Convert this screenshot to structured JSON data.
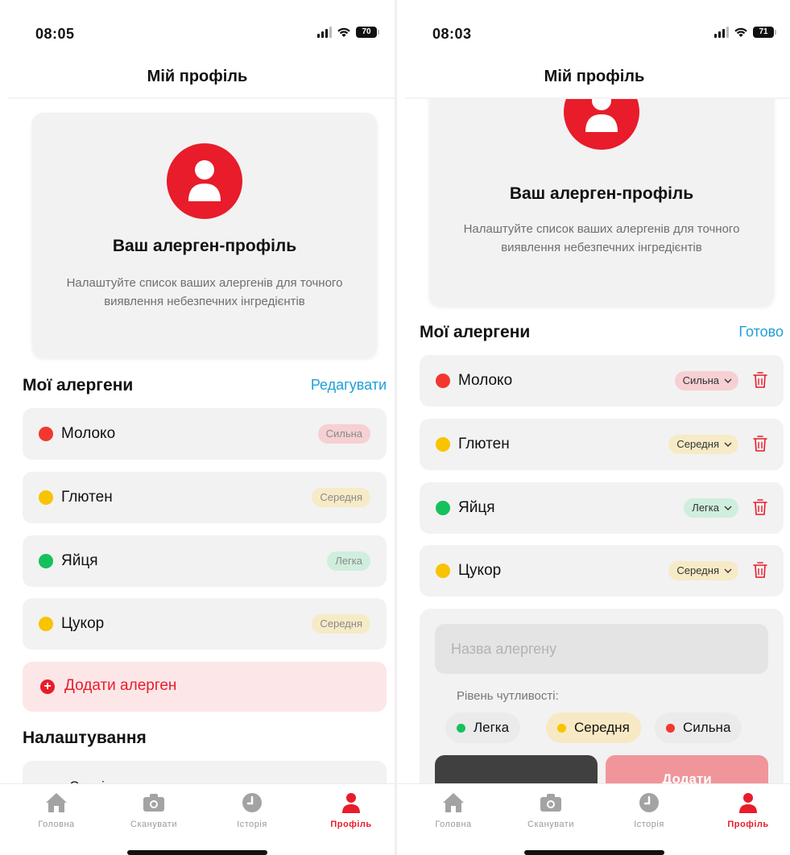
{
  "colors": {
    "accent": "#e81c2a",
    "link": "#1e9fd8",
    "strong": "#f2372f",
    "medium": "#f8c400",
    "light": "#16c15c"
  },
  "left": {
    "status": {
      "time": "08:05",
      "battery": "70"
    },
    "nav_title": "Мій профіль",
    "card": {
      "title": "Ваш алерген-профіль",
      "description": "Налаштуйте список ваших алергенів для точного виявлення небезпечних інгредієнтів"
    },
    "allergens_title": "Мої алергени",
    "edit_label": "Редагувати",
    "allergens": [
      {
        "name": "Молоко",
        "level": "Сильна"
      },
      {
        "name": "Глютен",
        "level": "Середня"
      },
      {
        "name": "Яйця",
        "level": "Легка"
      },
      {
        "name": "Цукор",
        "level": "Середня"
      }
    ],
    "add_allergen_label": "Додати алерген",
    "settings_title": "Налаштування",
    "settings_first_item": "Сповіщення"
  },
  "right": {
    "status": {
      "time": "08:03",
      "battery": "71"
    },
    "nav_title": "Мій профіль",
    "card": {
      "title": "Ваш алерген-профіль",
      "description": "Налаштуйте список ваших алергенів для точного виявлення небезпечних інгредієнтів"
    },
    "allergens_title": "Мої алергени",
    "done_label": "Готово",
    "allergens": [
      {
        "name": "Молоко",
        "level": "Сильна"
      },
      {
        "name": "Глютен",
        "level": "Середня"
      },
      {
        "name": "Яйця",
        "level": "Легка"
      },
      {
        "name": "Цукор",
        "level": "Середня"
      }
    ],
    "form": {
      "name_placeholder": "Назва алергену",
      "level_label": "Рівень чутливості:",
      "options": [
        "Легка",
        "Середня",
        "Сильна"
      ],
      "selected": "Середня",
      "add_button": "Додати"
    }
  },
  "tabs": [
    {
      "label": "Головна",
      "icon": "home-icon"
    },
    {
      "label": "Сканувати",
      "icon": "camera-icon"
    },
    {
      "label": "Історія",
      "icon": "clock-icon"
    },
    {
      "label": "Профіль",
      "icon": "person-icon",
      "active": true
    }
  ]
}
